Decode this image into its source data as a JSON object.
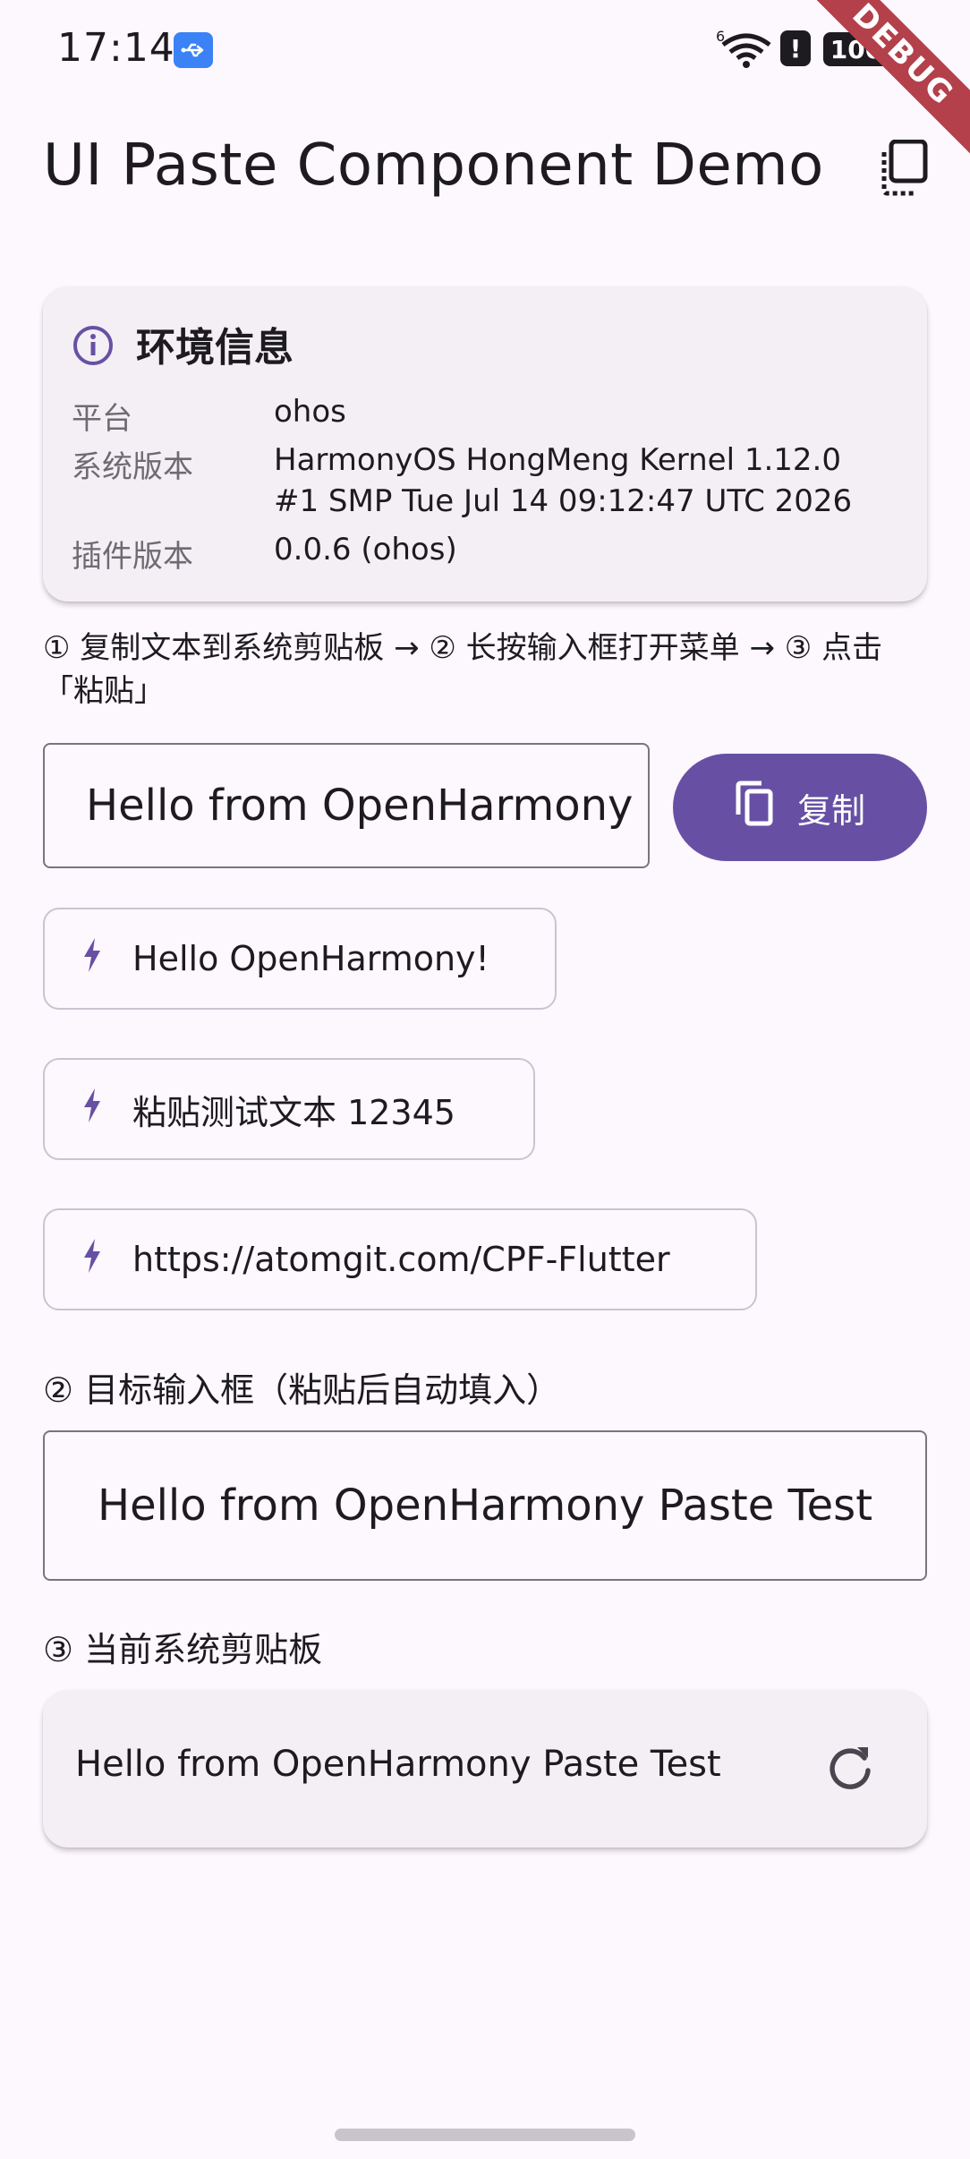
{
  "status_bar": {
    "time": "17:14",
    "signal_label": "6",
    "alert_glyph": "!",
    "battery": "100",
    "debug_banner": "DEBUG"
  },
  "app_bar": {
    "title": "UI Paste Component Demo",
    "action_icon": "paste-icon"
  },
  "env_card": {
    "title": "环境信息",
    "rows": [
      {
        "label": "平台",
        "value": "ohos"
      },
      {
        "label": "系统版本",
        "value_line1": "HarmonyOS HongMeng Kernel 1.12.0",
        "value_line2": "#1 SMP Tue Jul 14 09:12:47 UTC 2026"
      },
      {
        "label": "插件版本",
        "value": "0.0.6 (ohos)"
      }
    ]
  },
  "instruction": "① 复制文本到系统剪贴板 → ② 长按输入框打开菜单 → ③ 点击「粘贴」",
  "source_input": {
    "value": "Hello from OpenHarmony"
  },
  "copy_button": {
    "label": "复制"
  },
  "chips": [
    {
      "label": "Hello OpenHarmony!"
    },
    {
      "label": "粘贴测试文本 12345"
    },
    {
      "label": "https://atomgit.com/CPF-Flutter"
    }
  ],
  "target_section": {
    "label": "② 目标输入框（粘贴后自动填入）",
    "value": "Hello from OpenHarmony Paste Test"
  },
  "clipboard_section": {
    "label": "③ 当前系统剪贴板",
    "value": "Hello from OpenHarmony Paste Test"
  },
  "colors": {
    "primary": "#6750A4",
    "background": "#FDF7FE",
    "card": "#F4EFF4",
    "debug": "#B3404A"
  }
}
